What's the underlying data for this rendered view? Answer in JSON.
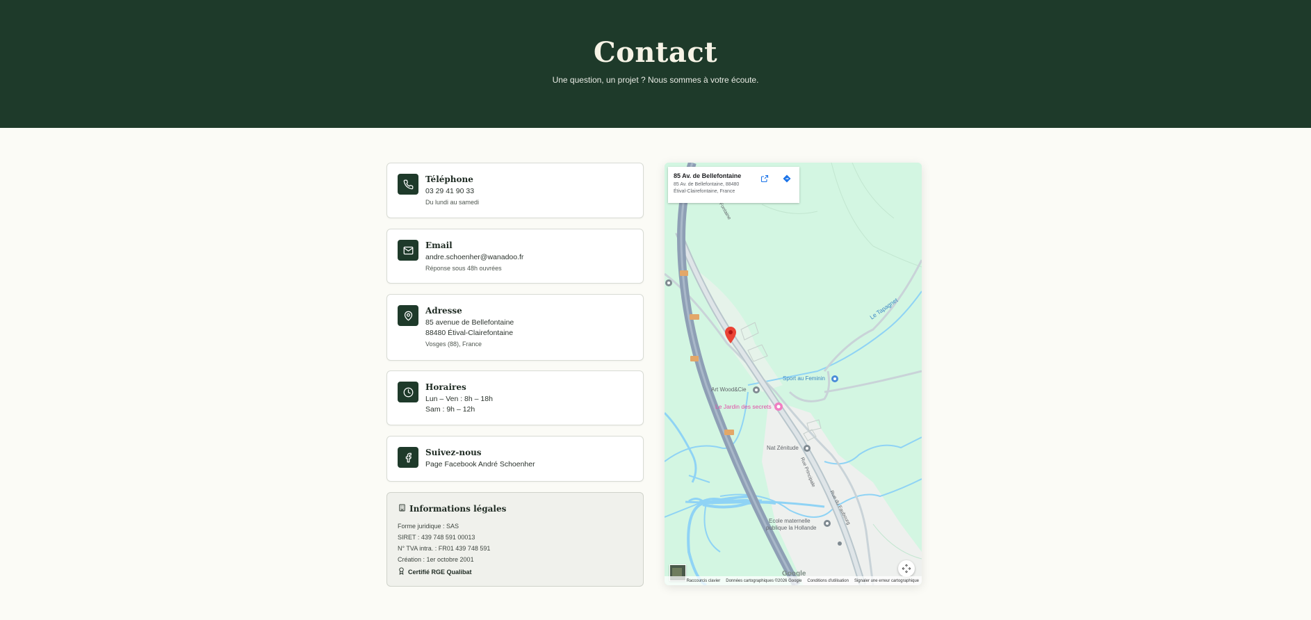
{
  "hero": {
    "title": "Contact",
    "subtitle": "Une question, un projet ? Nous sommes à votre écoute."
  },
  "cards": {
    "phone": {
      "icon": "phone-icon",
      "title": "Téléphone",
      "line1": "03 29 41 90 33",
      "note": "Du lundi au samedi"
    },
    "email": {
      "icon": "mail-icon",
      "title": "Email",
      "line1": "andre.schoenher@wanadoo.fr",
      "note": "Réponse sous 48h ouvrées"
    },
    "address": {
      "icon": "map-pin-icon",
      "title": "Adresse",
      "line1": "85 avenue de Bellefontaine",
      "line2": "88480 Étival-Clairefontaine",
      "note": "Vosges (88), France"
    },
    "hours": {
      "icon": "clock-icon",
      "title": "Horaires",
      "line1": "Lun – Ven : 8h – 18h",
      "line2": "Sam : 9h – 12h"
    },
    "social": {
      "icon": "facebook-icon",
      "title": "Suivez-nous",
      "line1": "Page Facebook André Schoenher"
    }
  },
  "legal": {
    "icon": "building-icon",
    "title": "Informations légales",
    "lines": [
      "Forme juridique : SAS",
      "SIRET : 439 748 591 00013",
      "N° TVA intra. : FR01 439 748 591",
      "Création : 1er octobre 2001"
    ],
    "certification_icon": "award-icon",
    "certification": "Certifié RGE Qualibat"
  },
  "map": {
    "place_name": "85 Av. de Bellefontaine",
    "place_address": "85 Av. de Bellefontaine, 88480 Étival-Clairefontaine, France",
    "labels": {
      "river": "Le Tapagnet",
      "road_top": "Rue Fontaine",
      "sport": "Sport au Feminin",
      "wood": "Art Wood&Cie",
      "jardin": "Le Jardin des secrets",
      "nat": "Nat Zénitude",
      "rue_principale": "Rue Principale",
      "rue_faubourg": "Rue du Faubourg",
      "ecole_1": "Ecole maternelle",
      "ecole_2": "publique la Hollande"
    },
    "google_logo": "Google",
    "attribution": {
      "shortcuts": "Raccourcis clavier",
      "data": "Données cartographiques ©2026 Google",
      "terms": "Conditions d'utilisation",
      "report": "Signaler une erreur cartographique"
    },
    "colors": {
      "land": "#d3f6e2",
      "water": "#8fd3f5",
      "highway": "#8e9fb5",
      "marker": "#ea4335"
    }
  }
}
